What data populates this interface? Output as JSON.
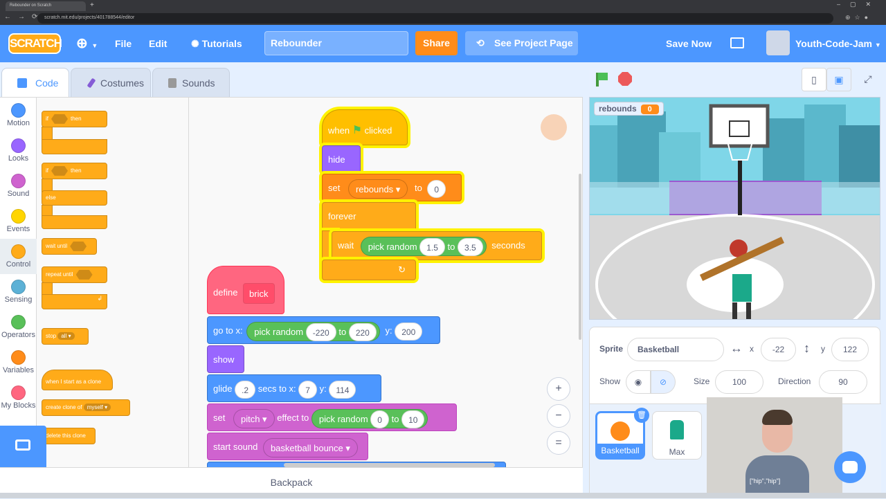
{
  "browser": {
    "tab_title": "Rebounder on Scratch",
    "url": "scratch.mit.edu/projects/401788544/editor"
  },
  "menu": {
    "logo": "SCRATCH",
    "file": "File",
    "edit": "Edit",
    "tutorials": "Tutorials",
    "project_title": "Rebounder",
    "share": "Share",
    "see_project": "See Project Page",
    "save_now": "Save Now",
    "username": "Youth-Code-Jam"
  },
  "editor_tabs": [
    "Code",
    "Costumes",
    "Sounds"
  ],
  "categories": [
    {
      "label": "Motion",
      "color": "#4c97ff"
    },
    {
      "label": "Looks",
      "color": "#9966ff"
    },
    {
      "label": "Sound",
      "color": "#cf63cf"
    },
    {
      "label": "Events",
      "color": "#ffd500"
    },
    {
      "label": "Control",
      "color": "#ffab19"
    },
    {
      "label": "Sensing",
      "color": "#5cb1d6"
    },
    {
      "label": "Operators",
      "color": "#59c059"
    },
    {
      "label": "Variables",
      "color": "#ff8c1a"
    },
    {
      "label": "My Blocks",
      "color": "#ff6680"
    }
  ],
  "palette": {
    "if": "if",
    "then": "then",
    "if2": "if",
    "then2": "then",
    "else": "else",
    "wait_until": "wait until",
    "repeat_until": "repeat until",
    "stop": "stop",
    "stop_opt": "all",
    "when_clone": "when I start as a clone",
    "create_clone": "create clone of",
    "create_clone_opt": "myself",
    "delete_clone": "delete this clone"
  },
  "script1": {
    "when": "when",
    "clicked": "clicked",
    "hide": "hide",
    "set": "set",
    "var": "rebounds",
    "to": "to",
    "value": "0",
    "forever": "forever",
    "wait": "wait",
    "pick_random": "pick random",
    "from": "1.5",
    "to2": "to",
    "upto": "3.5",
    "seconds": "seconds"
  },
  "script2": {
    "define": "define",
    "name": "brick",
    "goto": "go to x:",
    "pick_random": "pick random",
    "xmin": "-220",
    "to": "to",
    "xmax": "220",
    "y_label": "y:",
    "y": "200",
    "show": "show",
    "glide": "glide",
    "glide_secs": ".2",
    "secs_to_x": "secs to x:",
    "gx": "7",
    "gy_label": "y:",
    "gy": "114",
    "set": "set",
    "effect": "pitch",
    "effect_to": "effect to",
    "pick_random2": "pick random",
    "emin": "0",
    "to2": "to",
    "emax": "10",
    "start_sound": "start sound",
    "sound": "basketball bounce"
  },
  "backpack": "Backpack",
  "stage": {
    "monitor_label": "rebounds",
    "monitor_value": "0"
  },
  "sprite_info": {
    "sprite_label": "Sprite",
    "sprite_name": "Basketball",
    "x_label": "x",
    "x": "-22",
    "y_label": "y",
    "y": "122",
    "show_label": "Show",
    "size_label": "Size",
    "size": "100",
    "direction_label": "Direction",
    "direction": "90"
  },
  "sprites": [
    "Basketball",
    "Max"
  ],
  "webcam_shirt": "[\"hip\",\"hip\"]"
}
